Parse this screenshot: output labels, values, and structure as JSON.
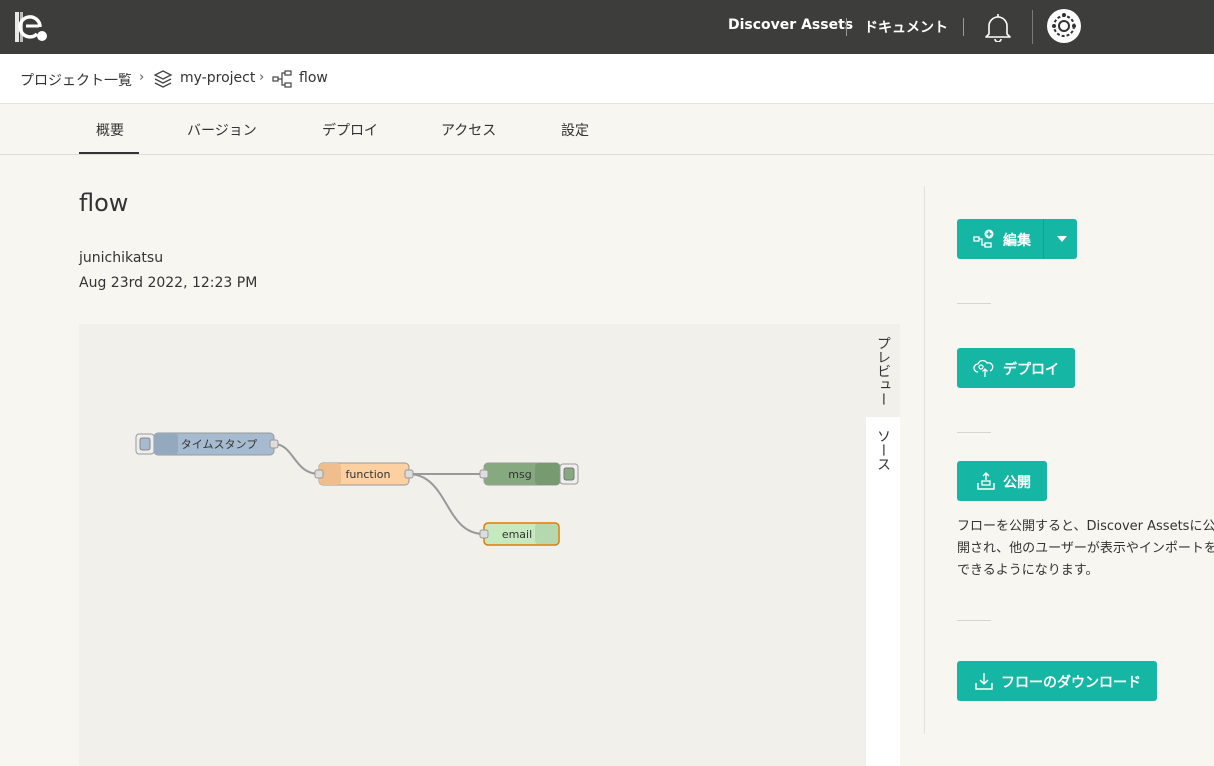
{
  "header": {
    "discover_assets": "Discover Assets",
    "documents": "ドキュメント",
    "icons": {
      "logo": "app-logo",
      "bell": "bell-icon",
      "avatar": "avatar"
    }
  },
  "breadcrumb": {
    "projects": "プロジェクト一覧",
    "separator": "›",
    "project": "my-project",
    "flow": "flow"
  },
  "tabs": [
    {
      "label": "概要",
      "active": true
    },
    {
      "label": "バージョン",
      "active": false
    },
    {
      "label": "デプロイ",
      "active": false
    },
    {
      "label": "アクセス",
      "active": false
    },
    {
      "label": "設定",
      "active": false
    }
  ],
  "main": {
    "title": "flow",
    "author": "junichikatsu",
    "date": "Aug 23rd 2022, 12:23 PM"
  },
  "preview": {
    "tabs": [
      {
        "label": "プレビュー",
        "active": true
      },
      {
        "label": "ソース",
        "active": false
      }
    ],
    "nodes": [
      {
        "label": "タイムスタンプ",
        "type": "inject",
        "color": "#a6bbcf"
      },
      {
        "label": "function",
        "type": "function",
        "color": "#fdd0a2"
      },
      {
        "label": "msg",
        "type": "debug",
        "color": "#87a980"
      },
      {
        "label": "email",
        "type": "email",
        "color": "#c7e9c0"
      }
    ]
  },
  "actions": {
    "edit": "編集",
    "deploy": "デプロイ",
    "publish": "公開",
    "publish_description": "フローを公開すると、Discover Assetsに公開され、他のユーザーが表示やインポートをできるようになります。",
    "download": "フローのダウンロード"
  },
  "colors": {
    "accent": "#15b6a4",
    "header_bg": "#3d3d3b",
    "page_bg": "#f7f6f0"
  }
}
